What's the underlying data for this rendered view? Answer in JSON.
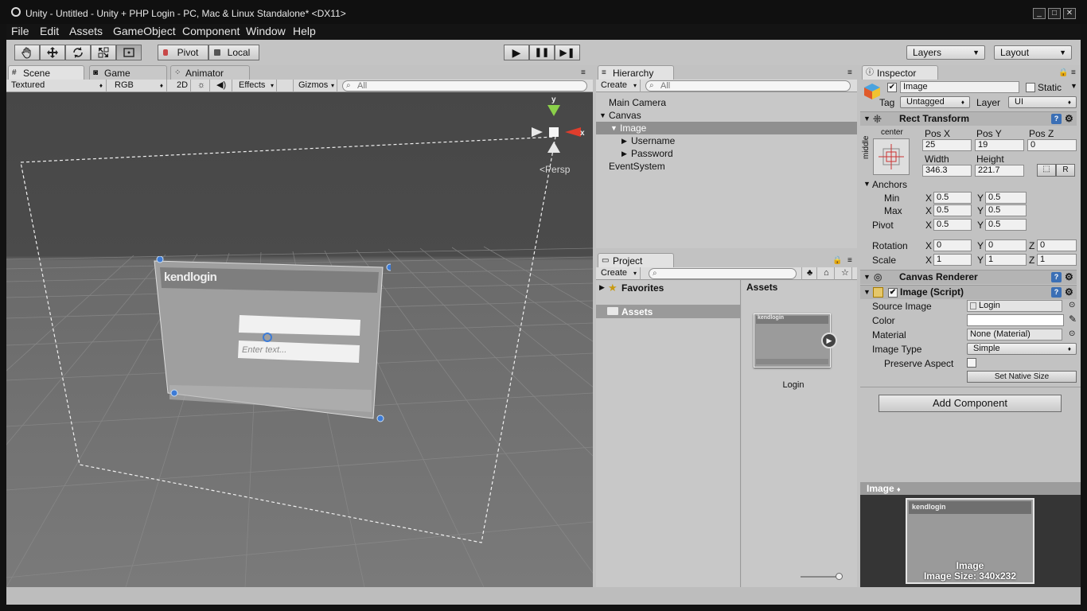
{
  "window": {
    "title": "Unity - Untitled - Unity + PHP Login - PC, Mac & Linux Standalone* <DX11>",
    "min": "_",
    "max": "□",
    "close": "✕"
  },
  "menu": [
    "File",
    "Edit",
    "Assets",
    "GameObject",
    "Component",
    "Window",
    "Help"
  ],
  "toolbar": {
    "tools": [
      "hand-tool",
      "move-tool",
      "rotate-tool",
      "scale-tool",
      "rect-tool"
    ],
    "pivot": "Pivot",
    "local": "Local",
    "play": "▶",
    "pause": "❚❚",
    "step": "▶❚",
    "layers": "Layers",
    "layout": "Layout"
  },
  "scene_tabs": [
    {
      "label": "Scene",
      "icon": "#"
    },
    {
      "label": "Game",
      "icon": "◙"
    },
    {
      "label": "Animator",
      "icon": "⁘"
    }
  ],
  "scene_bar": {
    "draw_mode": "Textured",
    "render": "RGB",
    "mode2d": "2D",
    "light": "☼",
    "audio": "◀)",
    "effects": "Effects",
    "gizmos": "Gizmos",
    "search_placeholder": "All"
  },
  "scene_view": {
    "gizmo_y": "y",
    "gizmo_x": "x",
    "persp": "Persp",
    "login_logo": "kendlogin",
    "input_placeholder": "Enter text..."
  },
  "hierarchy": {
    "tab": "Hierarchy",
    "create": "Create",
    "search_placeholder": "All",
    "items": [
      {
        "label": "Main Camera",
        "indent": 0,
        "arrow": ""
      },
      {
        "label": "Canvas",
        "indent": 0,
        "arrow": "▼"
      },
      {
        "label": "Image",
        "indent": 1,
        "arrow": "▼",
        "selected": true
      },
      {
        "label": "Username",
        "indent": 2,
        "arrow": "▶"
      },
      {
        "label": "Password",
        "indent": 2,
        "arrow": "▶"
      },
      {
        "label": "EventSystem",
        "indent": 0,
        "arrow": ""
      }
    ]
  },
  "project": {
    "tab": "Project",
    "create": "Create",
    "favorites": "Favorites",
    "assets_folder": "Assets",
    "assets_header": "Assets",
    "asset_name": "Login",
    "thumb_logo": "kendlogin"
  },
  "inspector": {
    "tab": "Inspector",
    "object_name": "Image",
    "static": "Static",
    "tag_label": "Tag",
    "tag_value": "Untagged",
    "layer_label": "Layer",
    "layer_value": "UI",
    "rect_transform": {
      "title": "Rect Transform",
      "anchor_h": "center",
      "anchor_v": "middle",
      "posx_label": "Pos X",
      "posy_label": "Pos Y",
      "posz_label": "Pos Z",
      "posx": "25",
      "posy": "19",
      "posz": "0",
      "width_label": "Width",
      "height_label": "Height",
      "width": "346.3",
      "height": "221.7",
      "r_btn": "R",
      "anchors_label": "Anchors",
      "min_label": "Min",
      "max_label": "Max",
      "pivot_label": "Pivot",
      "min_x": "0.5",
      "min_y": "0.5",
      "max_x": "0.5",
      "max_y": "0.5",
      "pivot_x": "0.5",
      "pivot_y": "0.5",
      "rotation_label": "Rotation",
      "rot_x": "0",
      "rot_y": "0",
      "rot_z": "0",
      "scale_label": "Scale",
      "scale_x": "1",
      "scale_y": "1",
      "scale_z": "1",
      "x": "X",
      "y": "Y",
      "z": "Z"
    },
    "canvas_renderer": "Canvas Renderer",
    "image_script": {
      "title": "Image (Script)",
      "source_label": "Source Image",
      "source_value": "Login",
      "color_label": "Color",
      "material_label": "Material",
      "material_value": "None (Material)",
      "type_label": "Image Type",
      "type_value": "Simple",
      "preserve_label": "Preserve Aspect",
      "native_btn": "Set Native Size"
    },
    "add_component": "Add Component",
    "preview_title": "Image",
    "preview_logo": "kendlogin",
    "preview_caption": "Image",
    "preview_size": "Image Size: 340x232"
  }
}
